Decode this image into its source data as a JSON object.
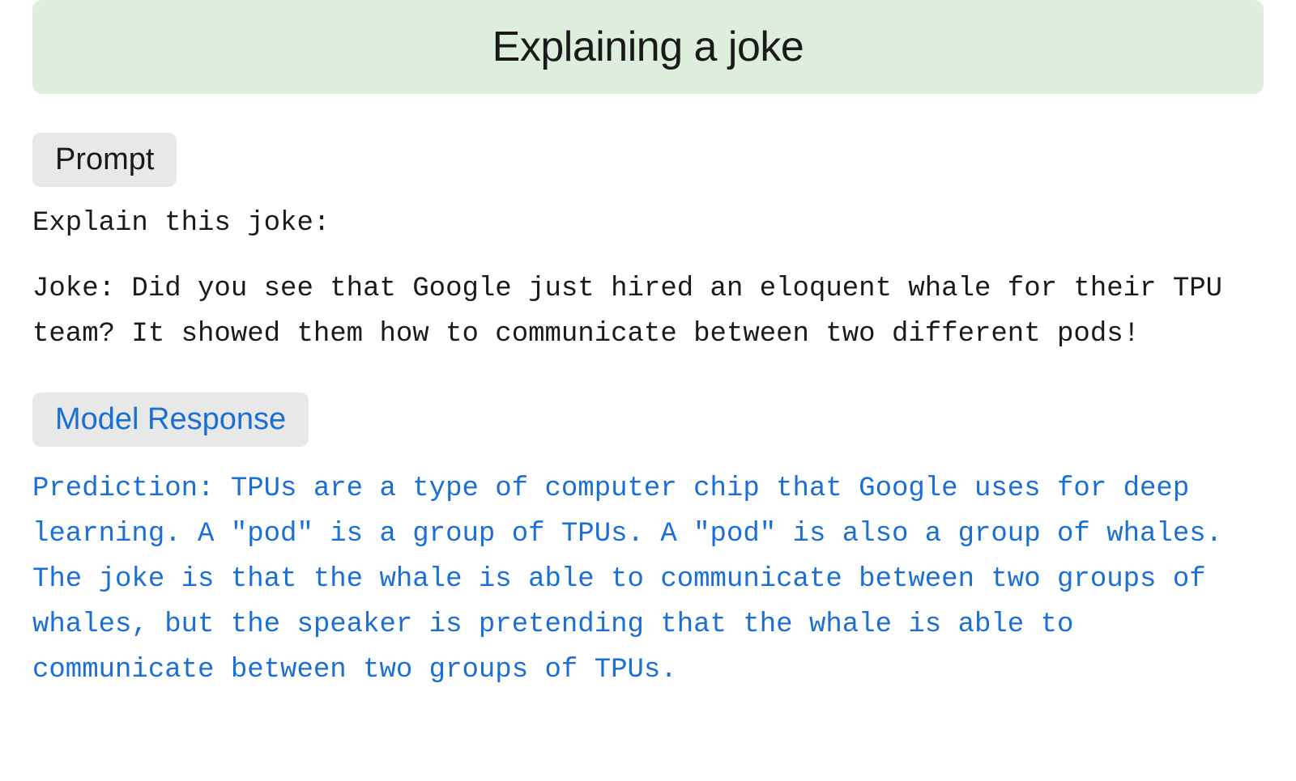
{
  "header": {
    "title": "Explaining a joke",
    "background_color": "#ddeedd"
  },
  "prompt_section": {
    "badge_label": "Prompt",
    "instruction": "Explain this joke:",
    "joke": "Joke: Did you see that Google just hired an eloquent whale for their TPU team? It showed them how to communicate between two different pods!"
  },
  "response_section": {
    "badge_label": "Model Response",
    "response_text": "Prediction: TPUs are a type of computer chip that Google uses for deep learning. A \"pod\" is a group of TPUs. A \"pod\" is also a group of whales. The joke is that the whale is able to communicate between two groups of whales, but the speaker is pretending that the whale is able to communicate between two groups of TPUs."
  }
}
